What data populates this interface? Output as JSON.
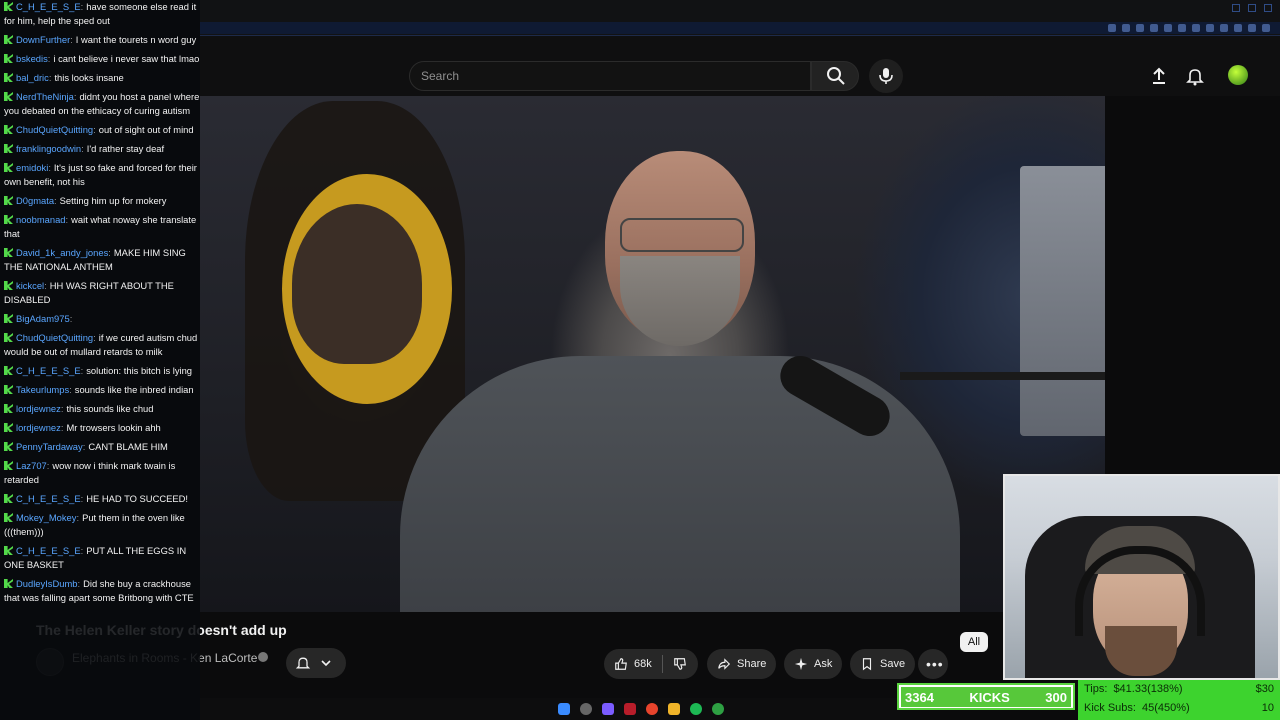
{
  "header": {
    "search_placeholder": "Search"
  },
  "video": {
    "title": "The Helen Keller story doesn't add up",
    "channel": "Elephants in Rooms - Ken LaCorte"
  },
  "actions": {
    "likes": "68k",
    "share": "Share",
    "ask": "Ask",
    "save": "Save"
  },
  "chips": {
    "all": "All"
  },
  "chat": {
    "messages": [
      {
        "user": "C_H_E_E_S_E",
        "text": "have someone else read it for him, help the sped out"
      },
      {
        "user": "DownFurther",
        "text": "I want the tourets n word guy"
      },
      {
        "user": "bskedis",
        "text": "i cant believe i never saw that lmao"
      },
      {
        "user": "bal_dric",
        "text": "this looks insane"
      },
      {
        "user": "NerdTheNinja",
        "text": "didnt you host a panel where you debated on the ethicacy of curing autism"
      },
      {
        "user": "ChudQuietQuitting",
        "text": "out of sight out of mind"
      },
      {
        "user": "franklingoodwin",
        "text": "I'd rather stay deaf"
      },
      {
        "user": "emidoki",
        "text": "It's just so fake and forced for their own benefit, not his"
      },
      {
        "user": "D0gmata",
        "text": "Setting him up for mokery"
      },
      {
        "user": "noobmanad",
        "text": "wait what noway she translate that"
      },
      {
        "user": "David_1k_andy_jones",
        "text": "MAKE HIM SING THE NATIONAL ANTHEM"
      },
      {
        "user": "kickcel",
        "text": "HH WAS RIGHT ABOUT THE DISABLED"
      },
      {
        "user": "BigAdam975",
        "text": ""
      },
      {
        "user": "ChudQuietQuitting",
        "text": "if we cured autism chud would be out of mullard retards to milk"
      },
      {
        "user": "C_H_E_E_S_E",
        "text": "solution: this bitch is lying"
      },
      {
        "user": "Takeurlumps",
        "text": "sounds like the inbred indian"
      },
      {
        "user": "lordjewnez",
        "text": "this sounds like chud"
      },
      {
        "user": "lordjewnez",
        "text": "Mr trowsers lookin ahh"
      },
      {
        "user": "PennyTardaway",
        "text": "CANT BLAME HIM"
      },
      {
        "user": "Laz707",
        "text": "wow now i think mark twain is retarded"
      },
      {
        "user": "C_H_E_E_S_E",
        "text": "HE HAD TO SUCCEED!"
      },
      {
        "user": "Mokey_Mokey",
        "text": "Put them in the oven like (((them)))"
      },
      {
        "user": "C_H_E_E_S_E",
        "text": "PUT ALL THE EGGS IN ONE BASKET"
      },
      {
        "user": "DudleyIsDumb",
        "text": "Did she buy a crackhouse that was falling apart some Britbong with CTE"
      }
    ]
  },
  "stream": {
    "kicks_count": "3364",
    "kicks_label": "KICKS",
    "kicks_goal": "300",
    "tips_label": "Tips:",
    "tips_value": "$41.33(138%)",
    "tips_goal": "$30",
    "subs_label": "Kick Subs:",
    "subs_value": "45(450%)",
    "subs_goal": "10"
  },
  "colors": {
    "chat_username": "#5aa6ff",
    "badge_green": "#53d94a",
    "kick_green": "#57c83a",
    "tips_green": "#3dd32e"
  }
}
